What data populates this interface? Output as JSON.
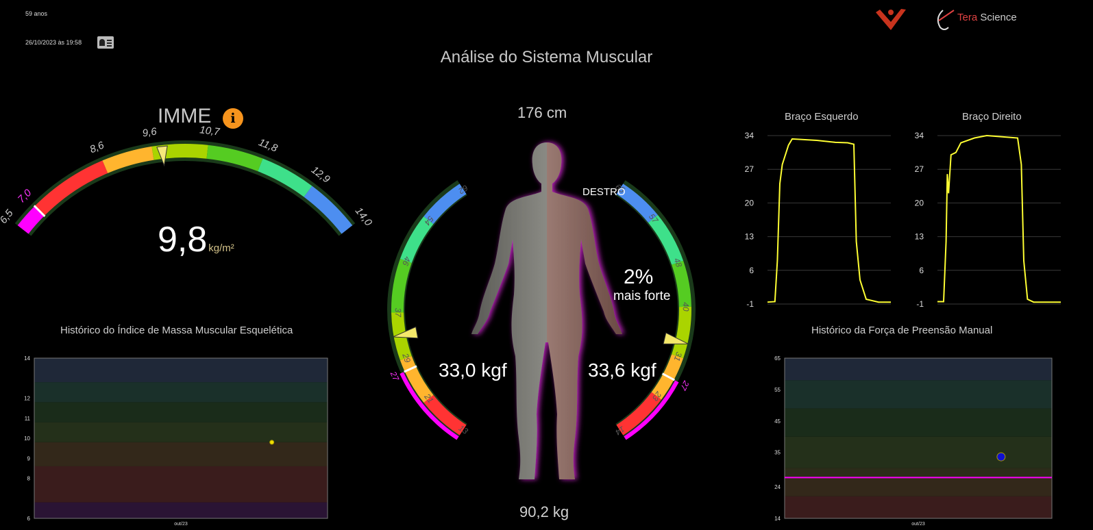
{
  "header": {
    "age": "59 anos",
    "datetime": "26/10/2023 às 19:58",
    "title": "Análise do Sistema Muscular",
    "brand_part1": "Tera",
    "brand_part2": " Science",
    "brand_color": "#e04242"
  },
  "imme": {
    "title": "IMME",
    "value": "9,8",
    "unit": "kg/m²",
    "ticks": [
      "6,5",
      "7,0",
      "8,6",
      "9,6",
      "10,7",
      "11,8",
      "12,9",
      "14,0"
    ],
    "pointer_value": 9.8
  },
  "body": {
    "height": "176 cm",
    "weight": "90,2 kg",
    "dominance": "DESTRO",
    "diff_percent": "2%",
    "diff_label": "mais forte",
    "left_force": "33,0 kgf",
    "right_force": "33,6 kgf",
    "left_scale_ticks": [
      "13",
      "21",
      "27",
      "29",
      "37",
      "46",
      "54",
      "62"
    ],
    "right_scale_ticks": [
      "14",
      "23",
      "27",
      "31",
      "40",
      "48",
      "57",
      "65"
    ],
    "left_force_value": 33.0,
    "right_force_value": 33.6
  },
  "arms": {
    "left_title": "Braço Esquerdo",
    "right_title": "Braço Direito",
    "y_ticks": [
      "34",
      "27",
      "20",
      "13",
      "6",
      "-1"
    ]
  },
  "history_imme": {
    "title": "Histórico do Índice de Massa Muscular Esquelética",
    "y_ticks": [
      "14",
      "12",
      "11",
      "10",
      "9",
      "8",
      "6"
    ],
    "x_label": "out/23",
    "point_value": 9.8,
    "point_color": "#f0e000"
  },
  "history_grip": {
    "title": "Histórico da Força de Preensão Manual",
    "y_ticks": [
      "65",
      "55",
      "45",
      "35",
      "24",
      "14"
    ],
    "x_label": "out/23",
    "point_value": 33.6,
    "threshold": 27,
    "point_color": "#1010d0",
    "threshold_color": "#ff00ff"
  }
}
